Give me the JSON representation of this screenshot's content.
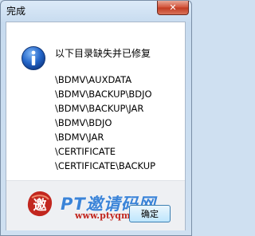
{
  "window": {
    "title": "完成"
  },
  "titlebar": {
    "close_glyph": "✕"
  },
  "dialog": {
    "icon": "info-icon",
    "heading": "以下目录缺失并已修复",
    "paths": [
      "\\BDMV\\AUXDATA",
      "\\BDMV\\BACKUP\\BDJO",
      "\\BDMV\\BACKUP\\JAR",
      "\\BDMV\\BDJO",
      "\\BDMV\\JAR",
      "\\CERTIFICATE",
      "\\CERTIFICATE\\BACKUP"
    ],
    "ok_label": "确定"
  },
  "watermark": {
    "logo_char": "邀",
    "site_name": "PT邀请码网",
    "url": "www.ptyqm.com"
  },
  "colors": {
    "accent": "#3b84d8",
    "close_red": "#c23b22",
    "watermark_red": "#c2271f"
  }
}
